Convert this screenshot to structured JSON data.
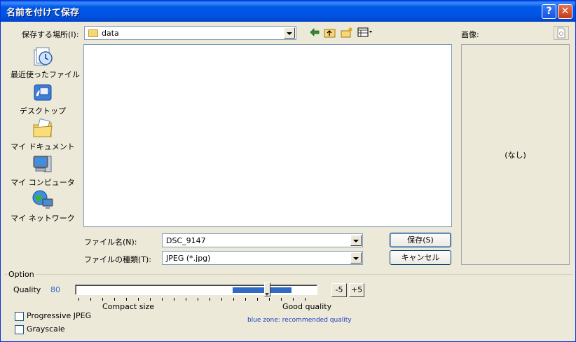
{
  "window": {
    "title": "名前を付けて保存"
  },
  "location": {
    "label": "保存する場所(I):",
    "folder": "data"
  },
  "preview": {
    "label": "画像:",
    "empty_text": "(なし)"
  },
  "places": [
    {
      "label": "最近使ったファイル",
      "icon": "recent-documents-icon"
    },
    {
      "label": "デスクトップ",
      "icon": "desktop-icon"
    },
    {
      "label": "マイ ドキュメント",
      "icon": "my-documents-icon"
    },
    {
      "label": "マイ コンピュータ",
      "icon": "my-computer-icon"
    },
    {
      "label": "マイ ネットワーク",
      "icon": "my-network-icon"
    }
  ],
  "form": {
    "filename_label": "ファイル名(N):",
    "filename_value": "DSC_9147",
    "filetype_label": "ファイルの種類(T):",
    "filetype_value": "JPEG (*.jpg)",
    "save_label": "保存(S)",
    "cancel_label": "キャンセル"
  },
  "option": {
    "legend": "Option",
    "quality_label": "Quality",
    "quality_value": "80",
    "quality_level": 80,
    "compact_label": "Compact size",
    "good_label": "Good quality",
    "minus_label": "-5",
    "plus_label": "+5",
    "hint": "blue zone: recommended quality",
    "progressive_label": "Progressive JPEG",
    "progressive_checked": false,
    "grayscale_label": "Grayscale",
    "grayscale_checked": false
  },
  "colors": {
    "accent": "#316ac5",
    "titlebar": "#0054e3",
    "face": "#ece9d8"
  }
}
